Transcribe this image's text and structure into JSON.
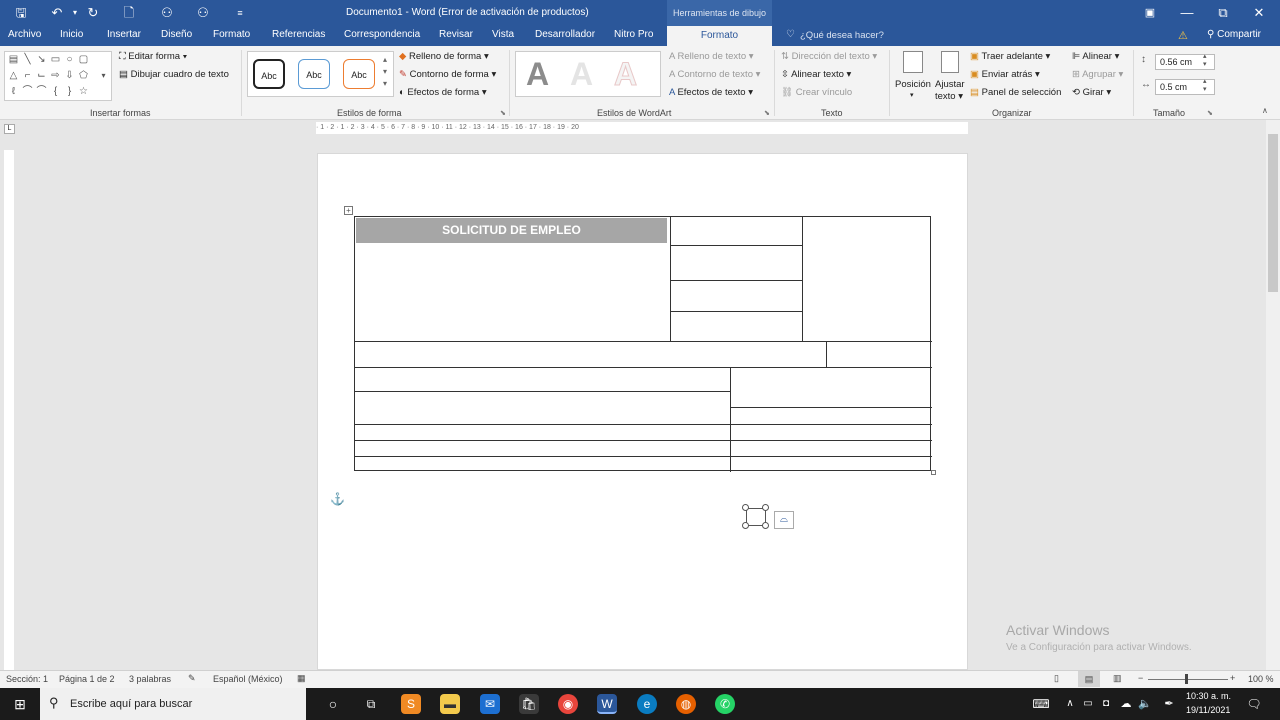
{
  "titlebar": {
    "title": "Documento1 - Word (Error de activación de productos)",
    "context_label": "Herramientas de dibujo",
    "save_icon": "save-icon",
    "min": "—",
    "restore": "⧉",
    "close": "✕"
  },
  "tabs": [
    "Archivo",
    "Inicio",
    "Insertar",
    "Diseño",
    "Formato",
    "Referencias",
    "Correspondencia",
    "Revisar",
    "Vista",
    "Desarrollador",
    "Nitro Pro"
  ],
  "active_tab": "Formato",
  "search_placeholder": "¿Qué desea hacer?",
  "share": "Compartir",
  "ribbon": {
    "insertar_formas": {
      "label": "Insertar formas",
      "editar": "Editar forma",
      "dibujar": "Dibujar cuadro de texto"
    },
    "estilos_forma": {
      "label": "Estilos de forma",
      "abc": "Abc",
      "relleno": "Relleno de forma",
      "contorno": "Contorno de forma",
      "efectos": "Efectos de forma"
    },
    "wordart": {
      "label": "Estilos de WordArt",
      "letter": "A",
      "relleno": "Relleno de texto",
      "contorno": "Contorno de texto",
      "efectos": "Efectos de texto"
    },
    "texto": {
      "label": "Texto",
      "direccion": "Dirección del texto",
      "alinear": "Alinear texto",
      "vinculo": "Crear vínculo"
    },
    "organizar": {
      "label": "Organizar",
      "posicion": "Posición",
      "ajustar1": "Ajustar",
      "ajustar2": "texto",
      "traer": "Traer adelante",
      "enviar": "Enviar atrás",
      "panel": "Panel de selección",
      "alinear": "Alinear",
      "agrupar": "Agrupar",
      "girar": "Girar"
    },
    "tamano": {
      "label": "Tamaño",
      "height": "0.56 cm",
      "width": "0.5 cm"
    }
  },
  "ruler_text": "· 1 · 2 · 1 · 2 · 3 · 4 · 5 · 6 · 7 · 8 · 9 · 10 · 11 · 12 · 13 · 14 · 15 · 16 · 17 · 18 · 19 · 20",
  "document": {
    "header_title": "SOLICITUD DE EMPLEO"
  },
  "watermark": {
    "line1": "Activar Windows",
    "line2": "Ve a Configuración para activar Windows."
  },
  "statusbar": {
    "section": "Sección: 1",
    "page": "Página 1 de 2",
    "words": "3 palabras",
    "language": "Español (México)",
    "zoom": "100 %"
  },
  "taskbar": {
    "search": "Escribe aquí para buscar",
    "time": "10:30 a. m.",
    "date": "19/11/2021"
  },
  "colors": {
    "word_blue": "#2b579a",
    "header_gray": "#a6a6a6"
  }
}
